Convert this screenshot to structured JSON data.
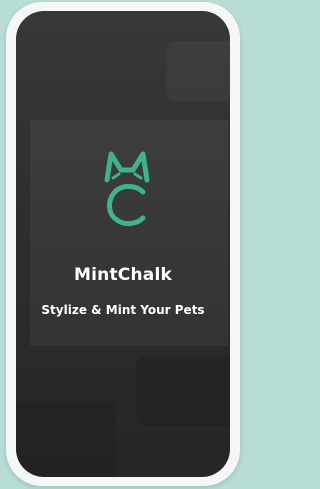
{
  "app": {
    "name": "MintChalk",
    "tagline": "Stylize & Mint Your Pets"
  },
  "logo": {
    "icon": "cat-c-logo-icon",
    "color": "#3fb489"
  },
  "colors": {
    "background": "#b8dcd6",
    "frame": "#f4f7f6",
    "screen": "#2f2f2f",
    "text": "#ffffff",
    "accent": "#3fb489"
  }
}
